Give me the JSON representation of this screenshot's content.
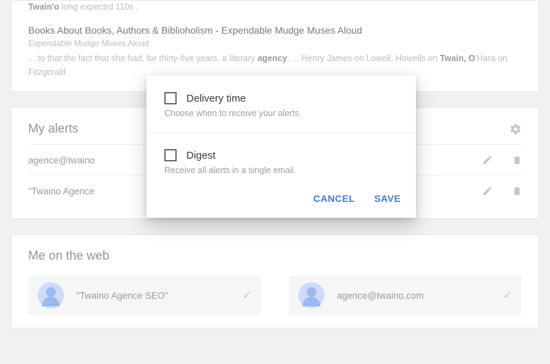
{
  "results": {
    "r1": {
      "bold1": "Twain'o",
      "text1": " long expectrd 110s ."
    },
    "r2": {
      "title": "Books About Books, Authors & Biblioholism - Expendable Mudge Muses Aloud",
      "source": "Expendable Mudge Muses Aloud",
      "snippet_pre": "... to that the fact that she had, for thirty-five years, a literary ",
      "snippet_b1": "agency",
      "snippet_mid": ". ... Henry James on Lowell, Howells on ",
      "snippet_b2": "Twain, O",
      "snippet_post": "'Hara on Fitzgerald"
    }
  },
  "alerts": {
    "heading": "My alerts ",
    "items": [
      {
        "label": "agence@twaino"
      },
      {
        "label": "\"Twaino Agence"
      }
    ]
  },
  "web": {
    "heading": "Me on the web",
    "items": [
      {
        "label": "\"Twaino Agence SEO\""
      },
      {
        "label": "agence@twaino.com"
      }
    ]
  },
  "modal": {
    "opt1_title": "Delivery time",
    "opt1_desc": "Choose when to receive your alerts.",
    "opt2_title": "Digest",
    "opt2_desc": "Receive all alerts in a single email.",
    "cancel": "CANCEL",
    "save": "SAVE"
  }
}
